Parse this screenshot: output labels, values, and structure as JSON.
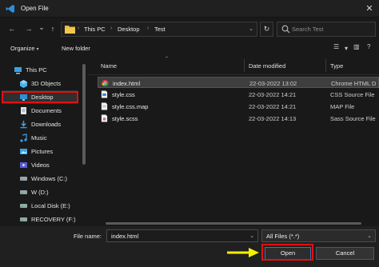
{
  "window": {
    "title": "Open File"
  },
  "nav": {
    "back": "←",
    "forward": "→",
    "recent": "⌄",
    "up": "↑",
    "breadcrumbs": [
      "This PC",
      "Desktop",
      "Test"
    ],
    "crumb_sep": "›",
    "refresh": "↻",
    "search_placeholder": "Search Test"
  },
  "toolbar": {
    "organize": "Organize",
    "new_folder": "New folder"
  },
  "sidebar": {
    "items": [
      {
        "label": "This PC",
        "icon": "pc-icon"
      },
      {
        "label": "3D Objects",
        "icon": "cube-icon"
      },
      {
        "label": "Desktop",
        "icon": "desktop-icon"
      },
      {
        "label": "Documents",
        "icon": "documents-icon"
      },
      {
        "label": "Downloads",
        "icon": "downloads-icon"
      },
      {
        "label": "Music",
        "icon": "music-icon"
      },
      {
        "label": "Pictures",
        "icon": "pictures-icon"
      },
      {
        "label": "Videos",
        "icon": "videos-icon"
      },
      {
        "label": "Windows (C:)",
        "icon": "drive-icon"
      },
      {
        "label": "W (D:)",
        "icon": "drive-icon"
      },
      {
        "label": "Local Disk (E:)",
        "icon": "drive-icon"
      },
      {
        "label": "RECOVERY (F:)",
        "icon": "drive-icon"
      }
    ],
    "selected": "Desktop"
  },
  "columns": {
    "name": "Name",
    "date": "Date modified",
    "type": "Type"
  },
  "files": [
    {
      "name": "index.html",
      "date": "22-03-2022 13:02",
      "type": "Chrome HTML D",
      "icon": "chrome-icon",
      "selected": true
    },
    {
      "name": "style.css",
      "date": "22-03-2022 14:21",
      "type": "CSS Source File",
      "icon": "css-file-icon"
    },
    {
      "name": "style.css.map",
      "date": "22-03-2022 14:21",
      "type": "MAP File",
      "icon": "map-file-icon"
    },
    {
      "name": "style.scss",
      "date": "22-03-2022 14:13",
      "type": "Sass Source File",
      "icon": "scss-file-icon"
    }
  ],
  "bottom": {
    "file_name_label": "File name:",
    "file_name_value": "index.html",
    "filter_value": "All Files (*.*)",
    "open_label": "Open",
    "cancel_label": "Cancel"
  },
  "colors": {
    "highlight_red": "#e31010",
    "arrow_yellow": "#f5f000",
    "background": "#191919"
  }
}
